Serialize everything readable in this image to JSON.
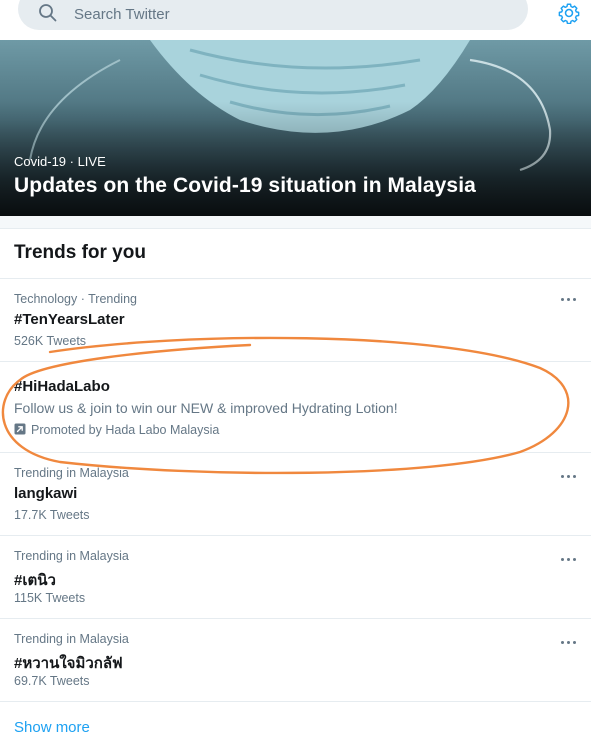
{
  "search": {
    "placeholder": "Search Twitter"
  },
  "icons": {
    "search": "search-icon",
    "settings": "gear-icon",
    "more": "more-dots-icon",
    "promoted": "promoted-arrow-icon"
  },
  "colors": {
    "accent": "#1da1f2",
    "annotation": "#f0883e",
    "secondary_text": "#657786"
  },
  "hero": {
    "category": "Covid-19 · LIVE",
    "title": "Updates on the Covid-19 situation in Malaysia"
  },
  "trends": {
    "heading": "Trends for you",
    "items": [
      {
        "meta": "Technology · Trending",
        "name": "#TenYearsLater",
        "count": "526K Tweets"
      },
      {
        "meta": "Trending in Malaysia",
        "name": "langkawi",
        "count": "17.7K Tweets"
      },
      {
        "meta": "Trending in Malaysia",
        "name": "#เตนิว",
        "count": "115K Tweets"
      },
      {
        "meta": "Trending in Malaysia",
        "name": "#หวานใจมิวกลัฟ",
        "count": "69.7K Tweets"
      }
    ],
    "promoted": {
      "name": "#HiHadaLabo",
      "description": "Follow us & join to win our NEW & improved Hydrating Lotion!",
      "promoted_by": "Promoted by Hada Labo Malaysia"
    },
    "show_more": "Show more"
  }
}
